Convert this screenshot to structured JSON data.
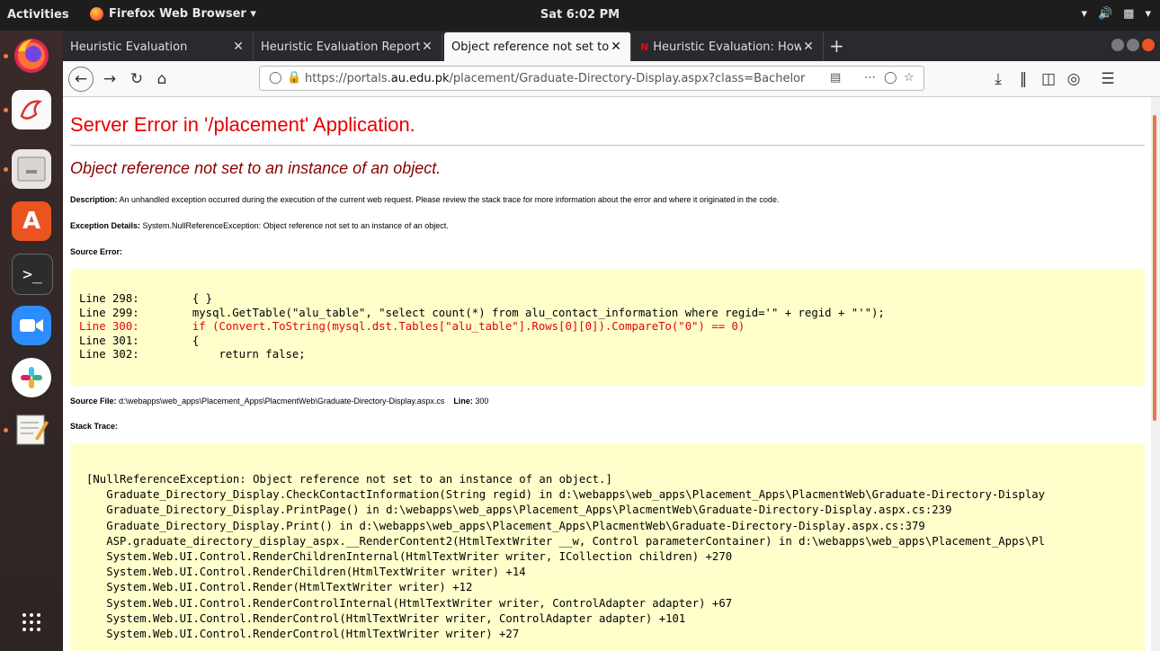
{
  "topbar": {
    "activities": "Activities",
    "app_menu": "Firefox Web Browser ▾",
    "clock": "Sat  6:02 PM"
  },
  "tabs": [
    {
      "title": "Heuristic Evaluation"
    },
    {
      "title": "Heuristic Evaluation Report"
    },
    {
      "title": "Object reference not set to"
    },
    {
      "title": "Heuristic Evaluation: How"
    }
  ],
  "urlbar": {
    "url_prefix": "https://portals.",
    "url_domain": "au.edu.pk",
    "url_path": "/placement/Graduate-Directory-Display.aspx?class=Bachelor O"
  },
  "page": {
    "heading": "Server Error in '/placement' Application.",
    "subheading": "Object reference not set to an instance of an object.",
    "description_label": "Description:",
    "description_text": " An unhandled exception occurred during the execution of the current web request. Please review the stack trace for more information about the error and where it originated in the code.",
    "exception_label": "Exception Details:",
    "exception_text": " System.NullReferenceException: Object reference not set to an instance of an object.",
    "source_error_label": "Source Error:",
    "source_lines": [
      {
        "text": "Line 298:        { }",
        "highlight": false
      },
      {
        "text": "Line 299:        mysql.GetTable(\"alu_table\", \"select count(*) from alu_contact_information where regid='\" + regid + \"'\");",
        "highlight": false
      },
      {
        "text": "Line 300:        if (Convert.ToString(mysql.dst.Tables[\"alu_table\"].Rows[0][0]).CompareTo(\"0\") == 0)",
        "highlight": true
      },
      {
        "text": "Line 301:        {",
        "highlight": false
      },
      {
        "text": "Line 302:            return false;",
        "highlight": false
      }
    ],
    "source_file_label": "Source File:",
    "source_file_path": " d:\\webapps\\web_apps\\Placement_Apps\\PlacmentWeb\\Graduate-Directory-Display.aspx.cs",
    "line_label": "Line:",
    "line_number": " 300",
    "stack_trace_label": "Stack Trace:",
    "stack_lines": [
      "[NullReferenceException: Object reference not set to an instance of an object.]",
      "   Graduate_Directory_Display.CheckContactInformation(String regid) in d:\\webapps\\web_apps\\Placement_Apps\\PlacmentWeb\\Graduate-Directory-Display",
      "   Graduate_Directory_Display.PrintPage() in d:\\webapps\\web_apps\\Placement_Apps\\PlacmentWeb\\Graduate-Directory-Display.aspx.cs:239",
      "   Graduate_Directory_Display.Print() in d:\\webapps\\web_apps\\Placement_Apps\\PlacmentWeb\\Graduate-Directory-Display.aspx.cs:379",
      "   ASP.graduate_directory_display_aspx.__RenderContent2(HtmlTextWriter __w, Control parameterContainer) in d:\\webapps\\web_apps\\Placement_Apps\\Pl",
      "   System.Web.UI.Control.RenderChildrenInternal(HtmlTextWriter writer, ICollection children) +270",
      "   System.Web.UI.Control.RenderChildren(HtmlTextWriter writer) +14",
      "   System.Web.UI.Control.Render(HtmlTextWriter writer) +12",
      "   System.Web.UI.Control.RenderControlInternal(HtmlTextWriter writer, ControlAdapter adapter) +67",
      "   System.Web.UI.Control.RenderControl(HtmlTextWriter writer, ControlAdapter adapter) +101",
      "   System.Web.UI.Control.RenderControl(HtmlTextWriter writer) +27"
    ]
  },
  "colors": {
    "error_red": "#e60000",
    "subheading_dark_red": "#8b0000",
    "code_background": "#ffffcc"
  }
}
